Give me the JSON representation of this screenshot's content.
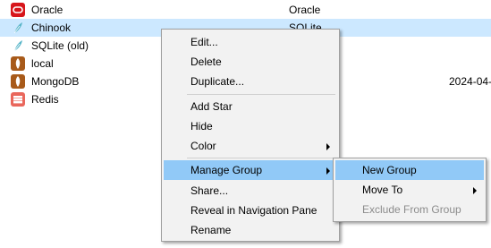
{
  "connections": [
    {
      "name": "Oracle",
      "type": "Oracle",
      "date": "",
      "icon": "oracle-icon",
      "color": "#d7161b",
      "selected": false
    },
    {
      "name": "Chinook",
      "type": "SQLite",
      "date": "",
      "icon": "sqlite-feather-icon",
      "color": "#5ab6c9",
      "selected": true
    },
    {
      "name": "SQLite (old)",
      "type": "",
      "date": "",
      "icon": "sqlite-feather-icon",
      "color": "#5ab6c9",
      "selected": false
    },
    {
      "name": "local",
      "type": "",
      "date": "",
      "icon": "mongodb-leaf-icon",
      "color": "#a85a1a",
      "selected": false
    },
    {
      "name": "MongoDB",
      "type": "",
      "date": "2024-04-",
      "icon": "mongodb-leaf-icon",
      "color": "#a85a1a",
      "selected": false
    },
    {
      "name": "Redis",
      "type": "",
      "date": "",
      "icon": "redis-icon",
      "color": "#e9675c",
      "selected": false
    }
  ],
  "context_menu": {
    "items": [
      {
        "label": "Edit...",
        "submenu": false
      },
      {
        "label": "Delete",
        "submenu": false
      },
      {
        "label": "Duplicate...",
        "submenu": false
      },
      {
        "label": "Add Star",
        "submenu": false
      },
      {
        "label": "Hide",
        "submenu": false
      },
      {
        "label": "Color",
        "submenu": true
      },
      {
        "label": "Manage Group",
        "submenu": true,
        "highlighted": true
      },
      {
        "label": "Share...",
        "submenu": false
      },
      {
        "label": "Reveal in Navigation Pane",
        "submenu": false
      },
      {
        "label": "Rename",
        "submenu": false
      }
    ]
  },
  "submenu": {
    "items": [
      {
        "label": "New Group",
        "highlighted": true,
        "submenu": false,
        "disabled": false
      },
      {
        "label": "Move To",
        "highlighted": false,
        "submenu": true,
        "disabled": false
      },
      {
        "label": "Exclude From Group",
        "highlighted": false,
        "submenu": false,
        "disabled": true
      }
    ]
  },
  "colors": {
    "selection": "#cce8ff",
    "menu_highlight": "#91c9f7",
    "menu_background": "#f2f2f2"
  }
}
